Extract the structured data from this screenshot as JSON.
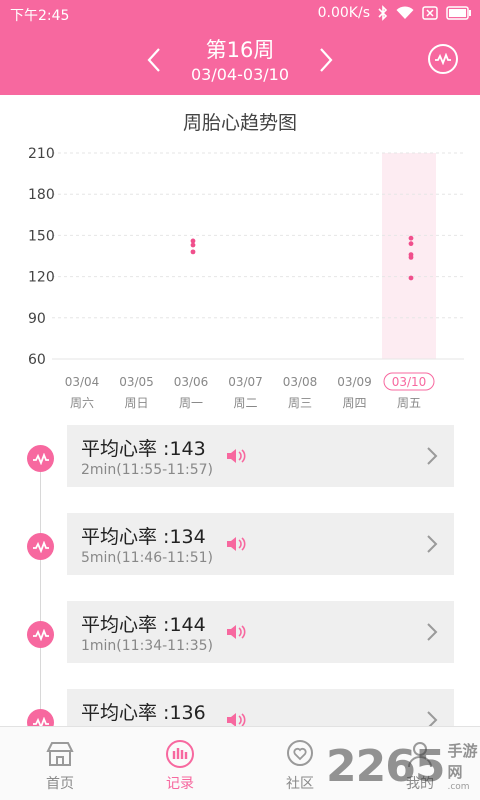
{
  "statusbar": {
    "time": "下午2:45",
    "speed": "0.00K/s"
  },
  "header": {
    "week_title": "第16周",
    "week_range": "03/04-03/10"
  },
  "chart_title": "周胎心趋势图",
  "chart_data": {
    "type": "scatter",
    "title": "周胎心趋势图",
    "categories": [
      "03/04",
      "03/05",
      "03/06",
      "03/07",
      "03/08",
      "03/09",
      "03/10"
    ],
    "weekdays": [
      "周六",
      "周日",
      "周一",
      "周二",
      "周三",
      "周四",
      "周五"
    ],
    "selected_category": "03/10",
    "ylim": [
      60,
      210
    ],
    "yticks": [
      60,
      90,
      120,
      150,
      180,
      210
    ],
    "grid": true,
    "series": [
      {
        "values": [
          {
            "x": "03/06",
            "y": 146
          },
          {
            "x": "03/06",
            "y": 143
          },
          {
            "x": "03/06",
            "y": 138
          },
          {
            "x": "03/10",
            "y": 148
          },
          {
            "x": "03/10",
            "y": 144
          },
          {
            "x": "03/10",
            "y": 136
          },
          {
            "x": "03/10",
            "y": 134
          },
          {
            "x": "03/10",
            "y": 119
          }
        ]
      }
    ],
    "point_color": "#f04f8c",
    "highlight_color": "#fdecf2"
  },
  "records": [
    {
      "label": "平均心率 :143",
      "time": "2min(11:55-11:57)"
    },
    {
      "label": "平均心率 :134",
      "time": "5min(11:46-11:51)"
    },
    {
      "label": "平均心率 :144",
      "time": "1min(11:34-11:35)"
    },
    {
      "label": "平均心率 :136",
      "time": ""
    }
  ],
  "nav": {
    "home": "首页",
    "records": "记录",
    "community": "社区",
    "mine": "我的"
  },
  "watermark": {
    "num": "2265",
    "cn": "手游网",
    "com": ".com"
  },
  "colors": {
    "accent": "#f7689f",
    "card": "#efefef"
  }
}
